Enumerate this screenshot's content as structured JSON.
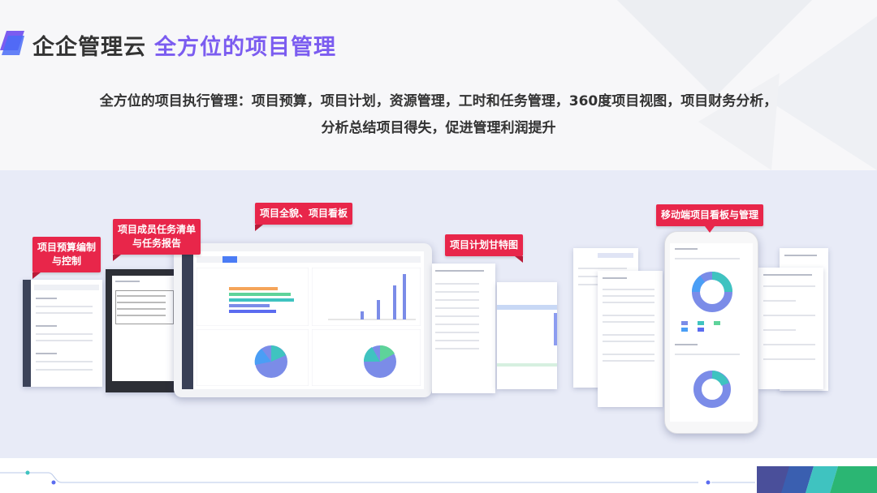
{
  "header": {
    "title_main": "企企管理云",
    "title_accent": "全方位的项目管理"
  },
  "description": {
    "line1": "全方位的项目执行管理：项目预算，项目计划，资源管理，工时和任务管理，360度项目视图，项目财务分析，",
    "line2": "分析总结项目得失，促进管理利润提升"
  },
  "callouts": {
    "budget": {
      "line1": "项目预算编制",
      "line2": "与控制"
    },
    "members": {
      "line1": "项目成员任务清单",
      "line2": "与任务报告"
    },
    "overview": "项目全貌、项目看板",
    "gantt": "项目计划甘特图",
    "mobile": "移动端项目看板与管理"
  },
  "colors": {
    "accent_purple": "#7b5cf0",
    "callout_red": "#e8264a",
    "band_bg": "#e8ebf7",
    "pie_blue": "#7b8ce8",
    "pie_teal": "#3fc3c0",
    "bar_orange": "#f5a55a",
    "bar_green": "#5ed39a"
  },
  "icons": {
    "logo": "stacked-parallelogram-logo",
    "corner": "diagonal-stripes-corner"
  }
}
